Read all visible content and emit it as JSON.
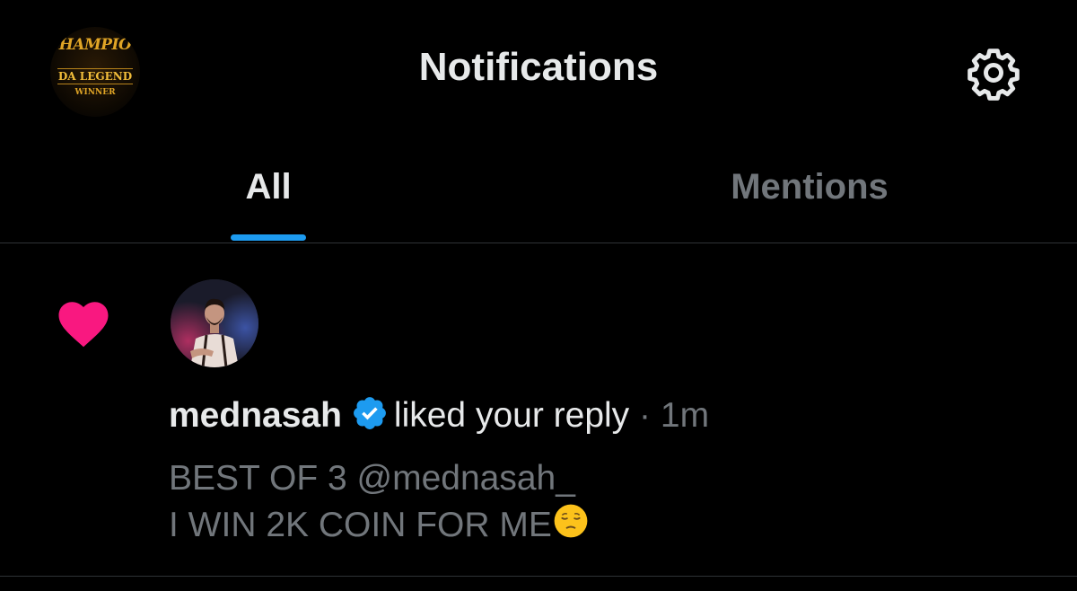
{
  "header": {
    "title": "Notifications",
    "profile_logo": {
      "top_text": "HAMPIO",
      "mid_text": "DA LEGEND",
      "bottom_text": "WINNER"
    },
    "settings_icon": "gear-icon"
  },
  "tabs": [
    {
      "label": "All",
      "active": true
    },
    {
      "label": "Mentions",
      "active": false
    }
  ],
  "notification": {
    "type_icon": "heart-icon",
    "username": "mednasah",
    "verified": true,
    "action": "liked your reply",
    "separator": "·",
    "timestamp": "1m",
    "tweet_lines": [
      "BEST OF 3 @mednasah_",
      "I WIN 2K COIN FOR ME"
    ],
    "emoji": "pensive-face-emoji"
  },
  "colors": {
    "background": "#000000",
    "text_primary": "#e7e9ea",
    "text_secondary": "#71767b",
    "accent": "#1d9bf0",
    "like": "#f91880",
    "divider": "#2f3336"
  }
}
